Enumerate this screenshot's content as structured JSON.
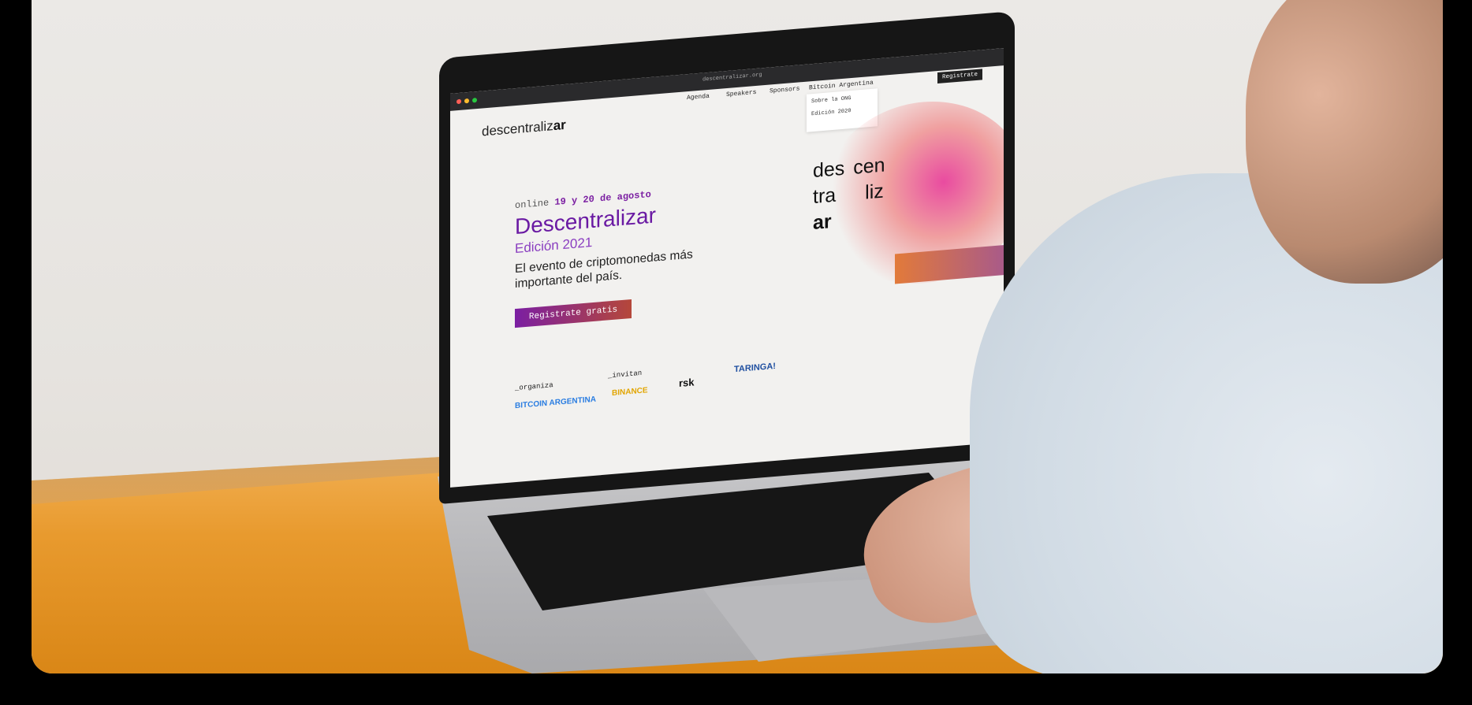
{
  "scene": "photo-of-laptop-showing-website",
  "colors": {
    "accent_purple": "#6a1aa3",
    "accent_orange": "#e89a2e",
    "screen_background": "#f2f1ef"
  },
  "browser": {
    "url": "descentralizar.org"
  },
  "site": {
    "logo_prefix": "descentraliz",
    "logo_suffix": "ar",
    "nav": [
      "Agenda",
      "Speakers",
      "Sponsors",
      "Bitcoin Argentina"
    ],
    "dropdown": [
      "Sobre la ONG",
      "Edición 2020"
    ],
    "register_nav": "Registrate",
    "date_prefix": "online",
    "date_highlight": "19 y 20 de agosto",
    "title": "Descentralizar",
    "edition": "Edición 2021",
    "tagline": "El evento de criptomonedas más importante del país.",
    "cta": "Registrate gratis",
    "stamp": [
      "des",
      "cen",
      "tra",
      "liz",
      "ar"
    ],
    "organiza_label": "_organiza",
    "invitan_label": "_invitan",
    "organizer": "BITCOIN ARGENTINA",
    "sponsors": [
      "BINANCE",
      "rsk",
      "TARINGA!"
    ]
  }
}
